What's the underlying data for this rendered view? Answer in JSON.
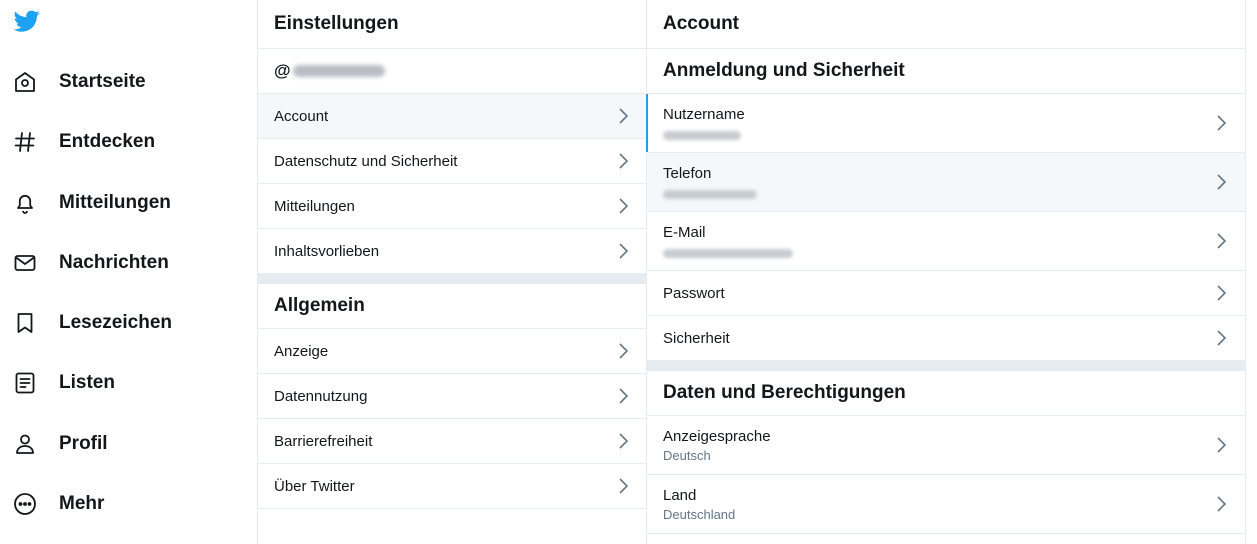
{
  "nav": {
    "logo_icon": "twitter-bird-icon",
    "items": [
      {
        "label": "Startseite",
        "icon": "home-icon"
      },
      {
        "label": "Entdecken",
        "icon": "hashtag-icon"
      },
      {
        "label": "Mitteilungen",
        "icon": "bell-icon"
      },
      {
        "label": "Nachrichten",
        "icon": "envelope-icon"
      },
      {
        "label": "Lesezeichen",
        "icon": "bookmark-icon"
      },
      {
        "label": "Listen",
        "icon": "list-icon"
      },
      {
        "label": "Profil",
        "icon": "person-icon"
      },
      {
        "label": "Mehr",
        "icon": "more-icon"
      }
    ]
  },
  "settings": {
    "title": "Einstellungen",
    "handle_prefix": "@",
    "account_items": [
      {
        "label": "Account"
      },
      {
        "label": "Datenschutz und Sicherheit"
      },
      {
        "label": "Mitteilungen"
      },
      {
        "label": "Inhaltsvorlieben"
      }
    ],
    "general_title": "Allgemein",
    "general_items": [
      {
        "label": "Anzeige"
      },
      {
        "label": "Datennutzung"
      },
      {
        "label": "Barrierefreiheit"
      },
      {
        "label": "Über Twitter"
      }
    ]
  },
  "account": {
    "title": "Account",
    "login_section_title": "Anmeldung und Sicherheit",
    "login_items": [
      {
        "label": "Nutzername"
      },
      {
        "label": "Telefon"
      },
      {
        "label": "E-Mail"
      },
      {
        "label": "Passwort"
      },
      {
        "label": "Sicherheit"
      }
    ],
    "data_section_title": "Daten und Berechtigungen",
    "data_items": [
      {
        "label": "Anzeigesprache",
        "value": "Deutsch"
      },
      {
        "label": "Land",
        "value": "Deutschland"
      }
    ]
  },
  "colors": {
    "accent": "#1da1f2",
    "border": "#e6ecf0",
    "text": "#14171a",
    "secondary": "#657786"
  }
}
